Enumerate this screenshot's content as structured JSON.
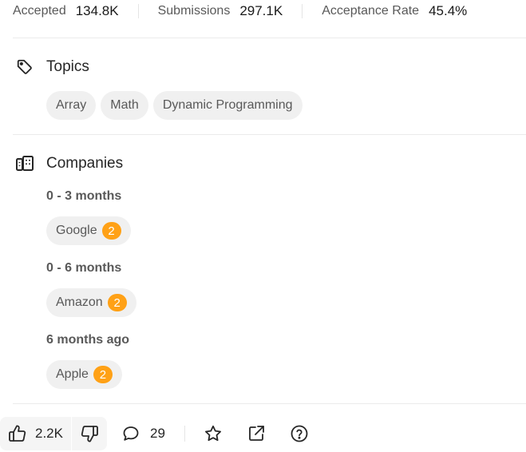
{
  "stats": {
    "accepted_label": "Accepted",
    "accepted_value": "134.8K",
    "submissions_label": "Submissions",
    "submissions_value": "297.1K",
    "acceptance_label": "Acceptance Rate",
    "acceptance_value": "45.4%"
  },
  "topics": {
    "title": "Topics",
    "icon": "tag-icon",
    "tags": [
      "Array",
      "Math",
      "Dynamic Programming"
    ]
  },
  "companies": {
    "title": "Companies",
    "icon": "building-icon",
    "groups": [
      {
        "period": "0 - 3 months",
        "companies": [
          {
            "name": "Google",
            "count": "2"
          }
        ]
      },
      {
        "period": "0 - 6 months",
        "companies": [
          {
            "name": "Amazon",
            "count": "2"
          }
        ]
      },
      {
        "period": "6 months ago",
        "companies": [
          {
            "name": "Apple",
            "count": "2"
          }
        ]
      }
    ]
  },
  "actions": {
    "likes": "2.2K",
    "comments": "29",
    "icons": [
      "thumbs-up-icon",
      "thumbs-down-icon",
      "comment-icon",
      "star-icon",
      "share-icon",
      "help-icon"
    ]
  },
  "colors": {
    "badge": "#ffa116",
    "chip_bg": "#f0f0f0",
    "text": "#262626",
    "muted": "#595959"
  }
}
